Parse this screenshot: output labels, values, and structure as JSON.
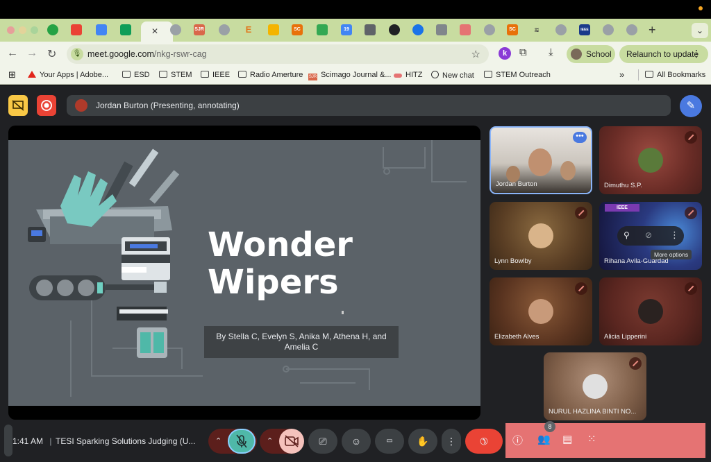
{
  "browser": {
    "url_host": "meet.google.com",
    "url_path": "/nkg-rswr-cag",
    "profile_label": "School",
    "relaunch_label": "Relaunch to update",
    "tab_labels": [
      "SJR",
      "E",
      "SC",
      "19",
      "SC",
      "IEEE"
    ],
    "bookmarks": [
      {
        "label": "Your Apps | Adobe...",
        "icon": "adobe-icon"
      },
      {
        "label": "ESD",
        "icon": "folder-icon"
      },
      {
        "label": "STEM",
        "icon": "folder-icon"
      },
      {
        "label": "IEEE",
        "icon": "folder-icon"
      },
      {
        "label": "Radio Amerture",
        "icon": "folder-icon"
      },
      {
        "label": "Scimago Journal &...",
        "icon": "sjr-icon"
      },
      {
        "label": "HITZ",
        "icon": "hitz-icon"
      },
      {
        "label": "New chat",
        "icon": "chat-icon"
      },
      {
        "label": "STEM Outreach",
        "icon": "folder-icon"
      }
    ],
    "all_bookmarks_label": "All Bookmarks",
    "overflow_label": "»",
    "sjr_badge": "SJR"
  },
  "meet": {
    "presenting_label": "Jordan Burton (Presenting, annotating)",
    "slide": {
      "title": "Wonder\nWipers",
      "byline": "By Stella C, Evelyn S, Anika M, Athena H, and Amelia C"
    },
    "participants": [
      {
        "name": "Jordan Burton"
      },
      {
        "name": "Dimuthu S.P."
      },
      {
        "name": "Lynn Bowlby"
      },
      {
        "name": "Rihana Avila-Guardado"
      },
      {
        "name": "Elizabeth Alves"
      },
      {
        "name": "Alicia Lipperini"
      },
      {
        "name": "NURUL HAZLINA BINTI NO..."
      }
    ],
    "ieee_tag": "IEEE",
    "more_options_tooltip": "More options",
    "clock": "1:41 AM",
    "separator": "|",
    "meeting_name": "TESI Sparking Solutions Judging (U...",
    "people_count": "8"
  },
  "colors": {
    "tabbar": "#c8dca0",
    "meet_bg": "#202124",
    "leave_red": "#ea4335",
    "panel_red": "#e57373",
    "slide_bg": "#5b6268"
  }
}
